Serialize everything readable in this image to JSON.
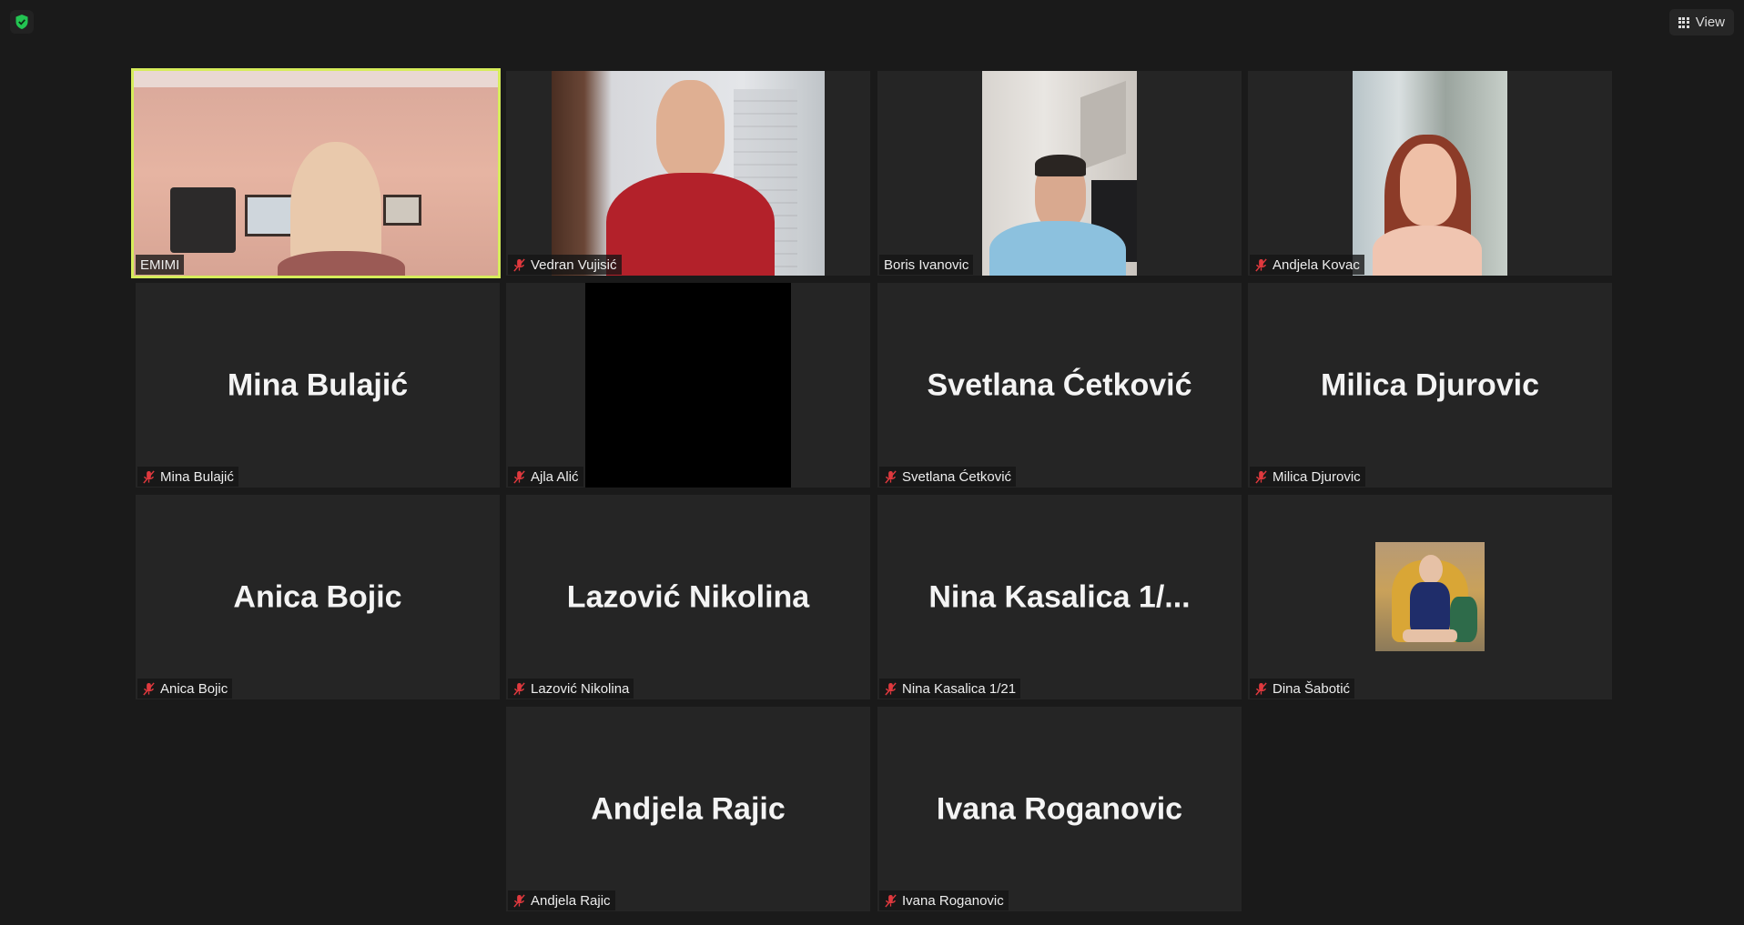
{
  "toolbar": {
    "view_label": "View"
  },
  "icons": {
    "security": "shield-check-icon",
    "view": "grid-view-icon",
    "muted": "mic-muted-icon"
  },
  "colors": {
    "active_speaker": "#d6ec5b",
    "muted_icon": "#e0393e",
    "shield": "#23c552"
  },
  "participants": [
    {
      "name": "EMIMI",
      "muted": false,
      "video": true,
      "active": true
    },
    {
      "name": "Vedran Vujisić",
      "muted": true,
      "video": true
    },
    {
      "name": "Boris Ivanovic",
      "muted": false,
      "video": true
    },
    {
      "name": "Andjela Kovac",
      "muted": true,
      "video": true
    },
    {
      "name": "Mina Bulajić",
      "display": "Mina Bulajić",
      "muted": true,
      "video": false
    },
    {
      "name": "Ajla Alić",
      "muted": true,
      "video": "black"
    },
    {
      "name": "Svetlana Ćetković",
      "display": "Svetlana Ćetković",
      "muted": true,
      "video": false
    },
    {
      "name": "Milica Djurovic",
      "display": "Milica Djurovic",
      "muted": true,
      "video": false
    },
    {
      "name": "Anica Bojic",
      "display": "Anica Bojic",
      "muted": true,
      "video": false
    },
    {
      "name": "Lazović Nikolina",
      "display": "Lazović Nikolina",
      "muted": true,
      "video": false
    },
    {
      "name": "Nina Kasalica 1/21",
      "display": "Nina Kasalica 1/...",
      "muted": true,
      "video": false
    },
    {
      "name": "Dina Šabotić",
      "muted": true,
      "video": "avatar"
    },
    {
      "name": "Andjela Rajic",
      "display": "Andjela Rajic",
      "muted": true,
      "video": false
    },
    {
      "name": "Ivana Roganovic",
      "display": "Ivana Roganovic",
      "muted": true,
      "video": false
    }
  ]
}
